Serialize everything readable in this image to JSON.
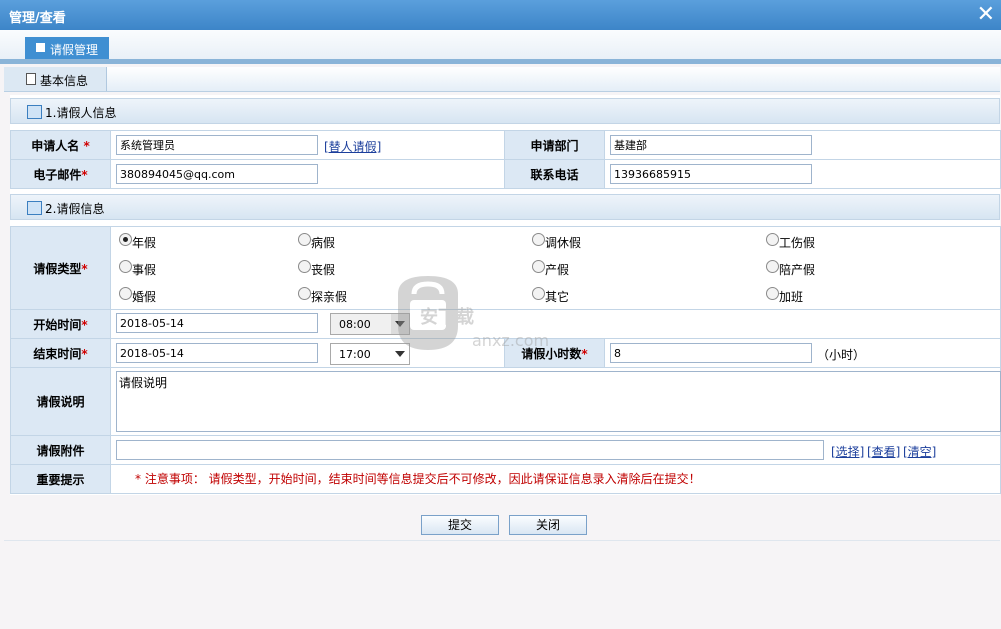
{
  "window": {
    "title": "管理/查看",
    "close": "✕"
  },
  "tab": {
    "label": "请假管理"
  },
  "section_tab": {
    "label": "基本信息"
  },
  "group1": {
    "title": "1.请假人信息"
  },
  "group2": {
    "title": "2.请假信息"
  },
  "applicant": {
    "name_label": "申请人名",
    "name_value": "系统管理员",
    "proxy_link": "[替人请假]",
    "dept_label": "申请部门",
    "dept_value": "基建部",
    "email_label": "电子邮件",
    "email_value": "380894045@qq.com",
    "phone_label": "联系电话",
    "phone_value": "13936685915"
  },
  "leave": {
    "type_label": "请假类型",
    "types": [
      "年假",
      "病假",
      "调休假",
      "工伤假",
      "事假",
      "丧假",
      "产假",
      "陪产假",
      "婚假",
      "探亲假",
      "其它",
      "加班"
    ],
    "selected_type": "年假",
    "start_label": "开始时间",
    "start_date": "2018-05-14",
    "start_time": "08:00",
    "end_label": "结束时间",
    "end_date": "2018-05-14",
    "end_time": "17:00",
    "hours_label": "请假小时数",
    "hours_value": "8",
    "hours_unit": "（小时）",
    "desc_label": "请假说明",
    "desc_value": "请假说明",
    "attach_label": "请假附件",
    "attach_links": [
      "[选择]",
      "[查看]",
      "[清空]"
    ],
    "notice_label": "重要提示",
    "notice_text": "* 注意事项： 请假类型，开始时间，结束时间等信息提交后不可修改，因此请保证信息录入清除后在提交！"
  },
  "buttons": {
    "submit": "提交",
    "close": "关闭"
  },
  "required_mark": "*",
  "watermark": {
    "brand": "安下载",
    "domain": "anxz.com"
  },
  "colors": {
    "title_bar": "#3d85c8",
    "label_bg": "#dce8f4",
    "required": "#d00000",
    "link": "#1c3f9c"
  }
}
